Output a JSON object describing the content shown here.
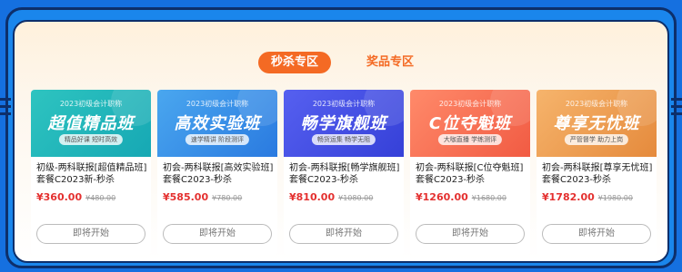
{
  "tabs": [
    {
      "label": "秒杀专区",
      "active": true
    },
    {
      "label": "奖品专区",
      "active": false
    }
  ],
  "cards": [
    {
      "banner_sub": "2023初级会计职称",
      "banner_title": "超值精品班",
      "banner_tagline": "精品好课 短时高效",
      "name": "初级-两科联报[超值精品班]套餐C2023新-秒杀",
      "price": "¥360.00",
      "original_price": "¥480.00",
      "button": "即将开始",
      "color_start": "#2ec4c0",
      "color_end": "#16a8b4"
    },
    {
      "banner_sub": "2023初级会计职称",
      "banner_title": "高效实验班",
      "banner_tagline": "速学精讲 阶段测评",
      "name": "初会-两科联报[高效实验班]套餐C2023-秒杀",
      "price": "¥585.00",
      "original_price": "¥780.00",
      "button": "即将开始",
      "color_start": "#4aa7ef",
      "color_end": "#2a7ae0"
    },
    {
      "banner_sub": "2023初级会计职称",
      "banner_title": "畅学旗舰班",
      "banner_tagline": "畅货运集 畅学无阻",
      "name": "初会-两科联报[畅学旗舰班]套餐C2023-秒杀",
      "price": "¥810.00",
      "original_price": "¥1080.00",
      "button": "即将开始",
      "color_start": "#5660f0",
      "color_end": "#3540d8"
    },
    {
      "banner_sub": "2023初级会计职称",
      "banner_title": "C位夺魁班",
      "banner_tagline": "大咖直播 学练测评",
      "name": "初会-两科联报[C位夺魁班]套餐C2023-秒杀",
      "price": "¥1260.00",
      "original_price": "¥1680.00",
      "button": "即将开始",
      "color_start": "#ff8a6a",
      "color_end": "#f15b43"
    },
    {
      "banner_sub": "2023初级会计职称",
      "banner_title": "尊享无忧班",
      "banner_tagline": "严管督学 助力上岗",
      "name": "初会-两科联报[尊享无忧班]套餐C2023-秒杀",
      "price": "¥1782.00",
      "original_price": "¥1980.00",
      "button": "即将开始",
      "color_start": "#f6b46c",
      "color_end": "#e58a3c"
    }
  ]
}
